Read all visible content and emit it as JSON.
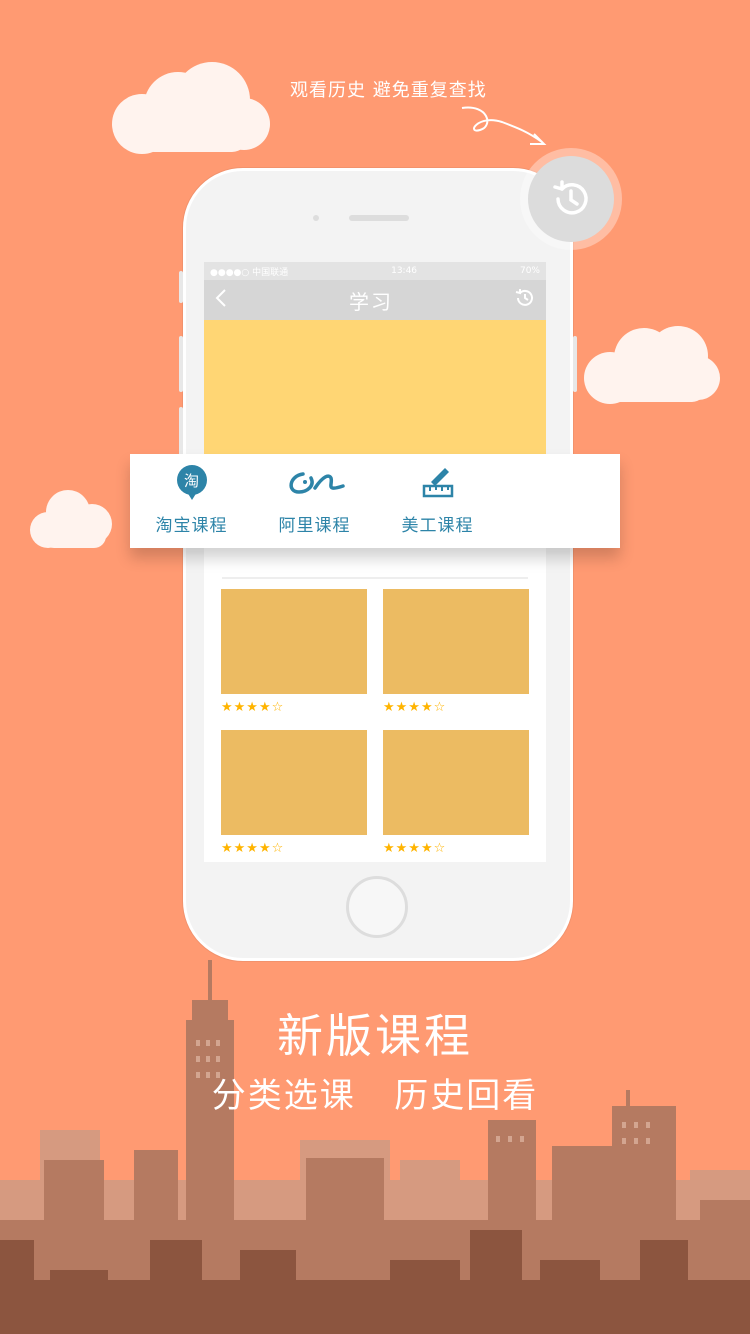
{
  "hint": {
    "text": "观看历史 避免重复查找"
  },
  "status_bar": {
    "carrier": "●●●●○ 中国联通",
    "time": "13:46",
    "battery": "70%"
  },
  "nav": {
    "title": "学习",
    "back_icon": "chevron-left-icon",
    "history_icon": "history-icon"
  },
  "categories": [
    {
      "label": "淘宝课程",
      "icon": "taobao-icon",
      "icon_char": "淘"
    },
    {
      "label": "阿里课程",
      "icon": "alibaba-icon"
    },
    {
      "label": "美工课程",
      "icon": "design-ruler-icon"
    }
  ],
  "courses": [
    {
      "rating_text": "★★★★☆",
      "rating": 4
    },
    {
      "rating_text": "★★★★☆",
      "rating": 4
    },
    {
      "rating_text": "★★★★☆",
      "rating": 4
    },
    {
      "rating_text": "★★★★☆",
      "rating": 4
    }
  ],
  "promo": {
    "headline": "新版课程",
    "subline": "分类选课   历史回看"
  },
  "colors": {
    "background": "#ff9a72",
    "banner": "#ffd674",
    "course_thumb": "#ecbb62",
    "accent": "#2d84a8",
    "star": "#ffb400"
  }
}
